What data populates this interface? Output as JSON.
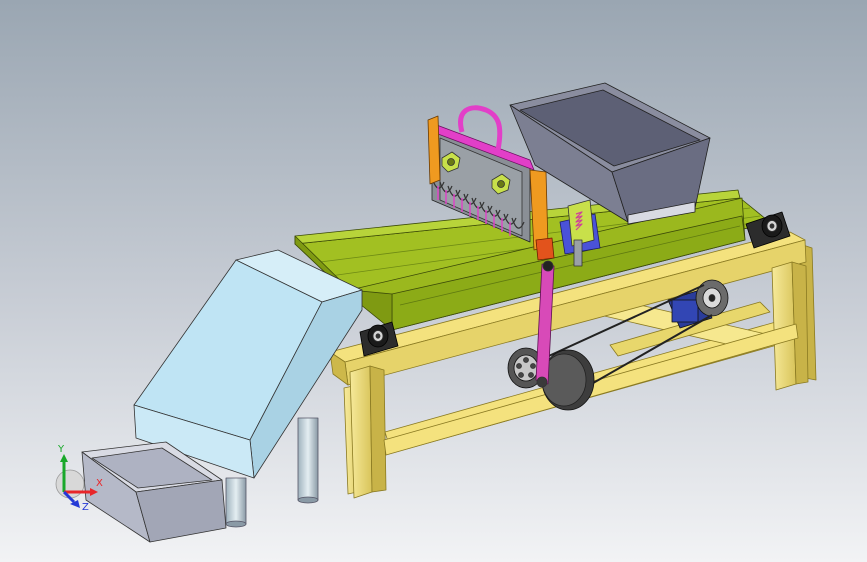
{
  "triad": {
    "x_label": "X",
    "y_label": "Y",
    "z_label": "Z",
    "x_color": "#e8262a",
    "y_color": "#19a82a",
    "z_color": "#2439d6"
  },
  "colors": {
    "background_top": "#9aa6b2",
    "background_bottom": "#f2f3f5",
    "frame_yellow": "#f4e27e",
    "frame_edge": "#8a7a22",
    "conveyor_green": "#a2c022",
    "conveyor_dark": "#5f7a10",
    "hopper_gray": "#7c7f92",
    "chute_blue": "#bfe4f4",
    "tray_gray": "#b5b9c8",
    "handle_magenta": "#e23fc8",
    "bracket_orange": "#ef9a20",
    "motor_blue": "#2a3c9a",
    "roller_blue": "#4a52d8"
  },
  "icons": [
    "coordinate-triad-icon"
  ]
}
